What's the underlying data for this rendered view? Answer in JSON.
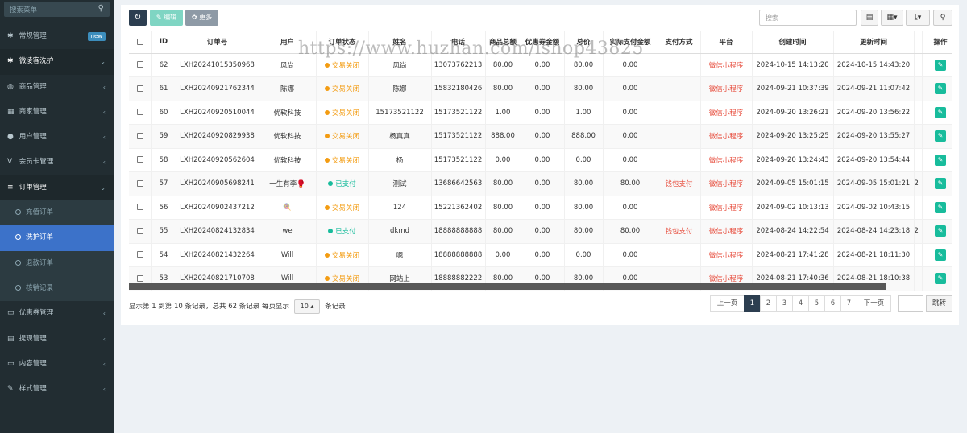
{
  "sidebar": {
    "search_placeholder": "搜索菜单",
    "items": [
      {
        "icon": "✱",
        "label": "常规管理",
        "badge": "new",
        "chevron": ""
      },
      {
        "icon": "✱",
        "label": "微凌客洗护",
        "badge": "",
        "chevron": "⌄",
        "open": true
      },
      {
        "icon": "◍",
        "label": "商品管理",
        "badge": "",
        "chevron": "‹"
      },
      {
        "icon": "▦",
        "label": "商家管理",
        "badge": "",
        "chevron": "‹"
      },
      {
        "icon": "●",
        "label": "用户管理",
        "badge": "",
        "chevron": "‹"
      },
      {
        "icon": "V",
        "label": "会员卡管理",
        "badge": "",
        "chevron": "‹"
      },
      {
        "icon": "≡",
        "label": "订单管理",
        "badge": "",
        "chevron": "⌄",
        "open": true
      }
    ],
    "subitems": [
      {
        "label": "充值订单",
        "active": false
      },
      {
        "label": "洗护订单",
        "active": true
      },
      {
        "label": "退款订单",
        "active": false
      },
      {
        "label": "核销记录",
        "active": false
      }
    ],
    "items_after": [
      {
        "icon": "▭",
        "label": "优惠券管理",
        "chevron": "‹"
      },
      {
        "icon": "▤",
        "label": "提现管理",
        "chevron": "‹"
      },
      {
        "icon": "▭",
        "label": "内容管理",
        "chevron": "‹"
      },
      {
        "icon": "✎",
        "label": "样式管理",
        "chevron": "‹"
      }
    ]
  },
  "toolbar": {
    "refresh_icon": "↻",
    "edit_label": "✎ 编辑",
    "more_label": "✿ 更多",
    "search_placeholder": "搜索",
    "view_icon": "▤",
    "columns_icon": "▦▾",
    "export_icon": "⤓▾",
    "search_icon": "⚲"
  },
  "table": {
    "columns": [
      "",
      "ID",
      "订单号",
      "用户",
      "订单状态",
      "姓名",
      "电话",
      "商品总额",
      "优惠券金额",
      "总价",
      "实际支付金额",
      "支付方式",
      "平台",
      "创建时间",
      "更新时间",
      "",
      "操作"
    ],
    "rows": [
      {
        "id": "62",
        "order_no": "LXH20241015350968",
        "user": "风尚",
        "status": "交易关闭",
        "status_type": "closed",
        "name": "风尚",
        "phone": "13073762213",
        "goods_total": "80.00",
        "coupon": "0.00",
        "total": "80.00",
        "paid": "0.00",
        "pay_method": "",
        "platform": "微信小程序",
        "created": "2024-10-15 14:13:20",
        "updated": "2024-10-15 14:43:20",
        "extra": ""
      },
      {
        "id": "61",
        "order_no": "LXH20240921762344",
        "user": "陈娜",
        "status": "交易关闭",
        "status_type": "closed",
        "name": "陈娜",
        "phone": "15832180426",
        "goods_total": "80.00",
        "coupon": "0.00",
        "total": "80.00",
        "paid": "0.00",
        "pay_method": "",
        "platform": "微信小程序",
        "created": "2024-09-21 10:37:39",
        "updated": "2024-09-21 11:07:42",
        "extra": ""
      },
      {
        "id": "60",
        "order_no": "LXH20240920510044",
        "user": "优软科技",
        "status": "交易关闭",
        "status_type": "closed",
        "name": "15173521122",
        "phone": "15173521122",
        "goods_total": "1.00",
        "coupon": "0.00",
        "total": "1.00",
        "paid": "0.00",
        "pay_method": "",
        "platform": "微信小程序",
        "created": "2024-09-20 13:26:21",
        "updated": "2024-09-20 13:56:22",
        "extra": ""
      },
      {
        "id": "59",
        "order_no": "LXH20240920829938",
        "user": "优软科技",
        "status": "交易关闭",
        "status_type": "closed",
        "name": "杨真真",
        "phone": "15173521122",
        "goods_total": "888.00",
        "coupon": "0.00",
        "total": "888.00",
        "paid": "0.00",
        "pay_method": "",
        "platform": "微信小程序",
        "created": "2024-09-20 13:25:25",
        "updated": "2024-09-20 13:55:27",
        "extra": ""
      },
      {
        "id": "58",
        "order_no": "LXH20240920562604",
        "user": "优软科技",
        "status": "交易关闭",
        "status_type": "closed",
        "name": "杨",
        "phone": "15173521122",
        "goods_total": "0.00",
        "coupon": "0.00",
        "total": "0.00",
        "paid": "0.00",
        "pay_method": "",
        "platform": "微信小程序",
        "created": "2024-09-20 13:24:43",
        "updated": "2024-09-20 13:54:44",
        "extra": ""
      },
      {
        "id": "57",
        "order_no": "LXH20240905698241",
        "user": "一生有李🥊",
        "status": "已支付",
        "status_type": "paid",
        "name": "测试",
        "phone": "13686642563",
        "goods_total": "80.00",
        "coupon": "0.00",
        "total": "80.00",
        "paid": "80.00",
        "pay_method": "钱包支付",
        "platform": "微信小程序",
        "created": "2024-09-05 15:01:15",
        "updated": "2024-09-05 15:01:21",
        "extra": "2"
      },
      {
        "id": "56",
        "order_no": "LXH20240902437212",
        "user": "🍭",
        "status": "交易关闭",
        "status_type": "closed",
        "name": "124",
        "phone": "15221362402",
        "goods_total": "80.00",
        "coupon": "0.00",
        "total": "80.00",
        "paid": "0.00",
        "pay_method": "",
        "platform": "微信小程序",
        "created": "2024-09-02 10:13:13",
        "updated": "2024-09-02 10:43:15",
        "extra": ""
      },
      {
        "id": "55",
        "order_no": "LXH20240824132834",
        "user": "we",
        "status": "已支付",
        "status_type": "paid",
        "name": "dkmd",
        "phone": "18888888888",
        "goods_total": "80.00",
        "coupon": "0.00",
        "total": "80.00",
        "paid": "80.00",
        "pay_method": "钱包支付",
        "platform": "微信小程序",
        "created": "2024-08-24 14:22:54",
        "updated": "2024-08-24 14:23:18",
        "extra": "2"
      },
      {
        "id": "54",
        "order_no": "LXH20240821432264",
        "user": "Will",
        "status": "交易关闭",
        "status_type": "closed",
        "name": "嗯",
        "phone": "18888888888",
        "goods_total": "0.00",
        "coupon": "0.00",
        "total": "0.00",
        "paid": "0.00",
        "pay_method": "",
        "platform": "微信小程序",
        "created": "2024-08-21 17:41:28",
        "updated": "2024-08-21 18:11:30",
        "extra": ""
      },
      {
        "id": "53",
        "order_no": "LXH20240821710708",
        "user": "Will",
        "status": "交易关闭",
        "status_type": "closed",
        "name": "网站上",
        "phone": "18888882222",
        "goods_total": "80.00",
        "coupon": "0.00",
        "total": "80.00",
        "paid": "0.00",
        "pay_method": "",
        "platform": "微信小程序",
        "created": "2024-08-21 17:40:36",
        "updated": "2024-08-21 18:10:38",
        "extra": ""
      }
    ]
  },
  "footer": {
    "info_prefix": "显示第 1 到第 10 条记录，总共 62 条记录 每页显示",
    "page_size": "10 ▴",
    "info_suffix": "条记录",
    "pages": [
      "上一页",
      "1",
      "2",
      "3",
      "4",
      "5",
      "6",
      "7",
      "下一页"
    ],
    "current_page": "1",
    "jump_label": "跳转"
  },
  "watermark": "https://www.huzhan.com/ishop43825",
  "colors": {
    "sidebar_bg": "#222d32",
    "active_item": "#3c72c9",
    "status_closed": "#f39c12",
    "status_paid": "#18bc9c",
    "pay_red": "#e74c3c",
    "pager_active": "#2c3e50"
  }
}
